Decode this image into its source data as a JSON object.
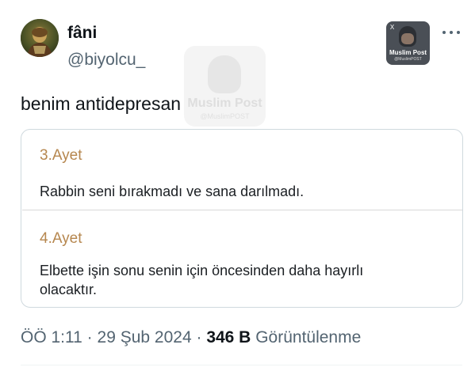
{
  "tweet": {
    "author": {
      "display_name": "fâni",
      "handle": "@biyolcu_",
      "avatar_icon": "profile-photo"
    },
    "text": "benim antidepresan",
    "watermark": {
      "title": "Muslim Post",
      "handle": "@MuslimPOST"
    },
    "badge": {
      "title": "Muslim Post",
      "handle": "@MuslimPOST",
      "x_mark": "X"
    },
    "more_icon": "more-horizontal-icon",
    "quote": {
      "verses": [
        {
          "heading": "3.Ayet",
          "text": "Rabbin seni bırakmadı ve sana darılmadı."
        },
        {
          "heading": "4.Ayet",
          "text": "Elbette işin sonu senin için öncesinden daha hayırlı olacaktır."
        }
      ],
      "heading_color": "#b6874f"
    },
    "meta": {
      "time": "ÖÖ 1:11",
      "separator": "·",
      "date": "29 Şub 2024",
      "views_count": "346 B",
      "views_label": "Görüntülenme"
    }
  }
}
